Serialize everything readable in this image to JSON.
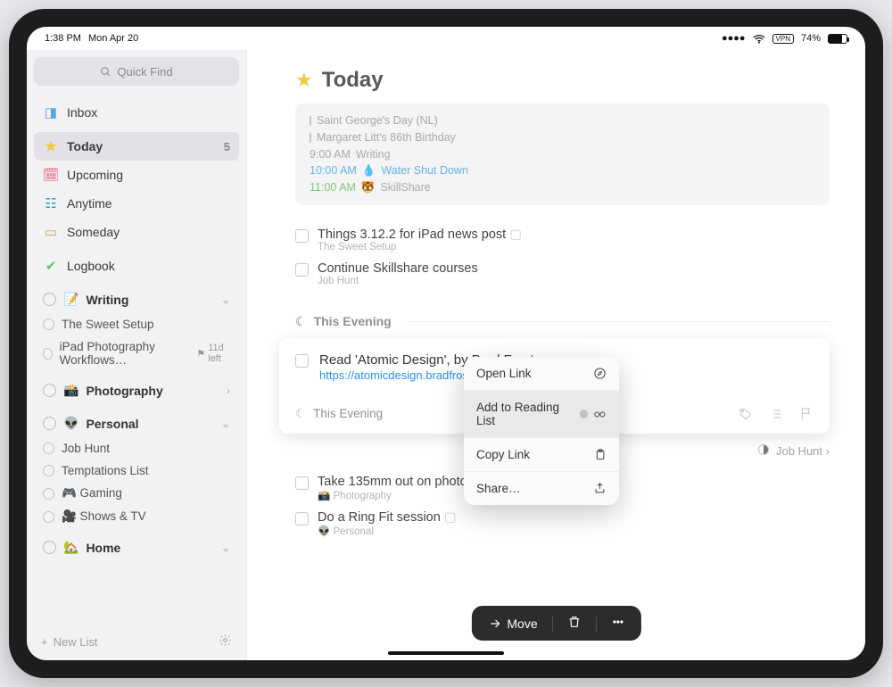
{
  "statusbar": {
    "time": "1:38 PM",
    "date": "Mon Apr 20",
    "vpn": "VPN",
    "battery_pct": "74%",
    "battery_fill_pct": 74
  },
  "sidebar": {
    "quickfind_label": "Quick Find",
    "inbox": "Inbox",
    "today": "Today",
    "today_count": "5",
    "upcoming": "Upcoming",
    "anytime": "Anytime",
    "someday": "Someday",
    "logbook": "Logbook",
    "areas": [
      {
        "emoji": "📝",
        "name": "Writing",
        "expanded": true,
        "projects": [
          {
            "name": "The Sweet Setup"
          },
          {
            "name": "iPad Photography Workflows…",
            "deadline": "11d left"
          }
        ]
      },
      {
        "emoji": "📸",
        "name": "Photography",
        "expanded": false
      },
      {
        "emoji": "👽",
        "name": "Personal",
        "expanded": true,
        "projects": [
          {
            "name": "Job Hunt"
          },
          {
            "name": "Temptations List"
          },
          {
            "name": "🎮 Gaming"
          },
          {
            "name": "🎥 Shows & TV"
          }
        ]
      },
      {
        "emoji": "🏡",
        "name": "Home",
        "expanded": false
      }
    ],
    "new_list": "New List"
  },
  "main": {
    "title": "Today",
    "calendar": [
      {
        "kind": "allday",
        "text": "Saint George's Day (NL)"
      },
      {
        "kind": "allday",
        "text": "Margaret Litt's 86th Birthday"
      },
      {
        "kind": "timed",
        "time": "9:00 AM",
        "text": "Writing"
      },
      {
        "kind": "timed",
        "time": "10:00 AM",
        "emoji": "💧",
        "text": "Water Shut Down",
        "color": "blue"
      },
      {
        "kind": "timed",
        "time": "11:00 AM",
        "emoji": "🐯",
        "text": "SkillShare",
        "color": "green"
      }
    ],
    "tasks_today": [
      {
        "title": "Things 3.12.2 for iPad news post",
        "subtitle": "The Sweet Setup",
        "has_notes": true
      },
      {
        "title": "Continue Skillshare courses",
        "subtitle": "Job Hunt"
      }
    ],
    "evening_header": "This Evening",
    "selected_task": {
      "title": "Read 'Atomic Design', by Brad Frost",
      "url": "https://atomicdesign.bradfrost.com/table-of-contents/",
      "when_label": "This Evening"
    },
    "jobhunt_label": "Job Hunt",
    "evening_tasks": [
      {
        "title": "Take 135mm out on photo walk",
        "subtitle": "📸 Photography"
      },
      {
        "title": "Do a Ring Fit session",
        "subtitle": "👽 Personal",
        "has_notes": true
      }
    ],
    "toolbar": {
      "move": "Move"
    }
  },
  "popup": {
    "open": "Open Link",
    "add": "Add to Reading List",
    "copy": "Copy Link",
    "share": "Share…"
  }
}
